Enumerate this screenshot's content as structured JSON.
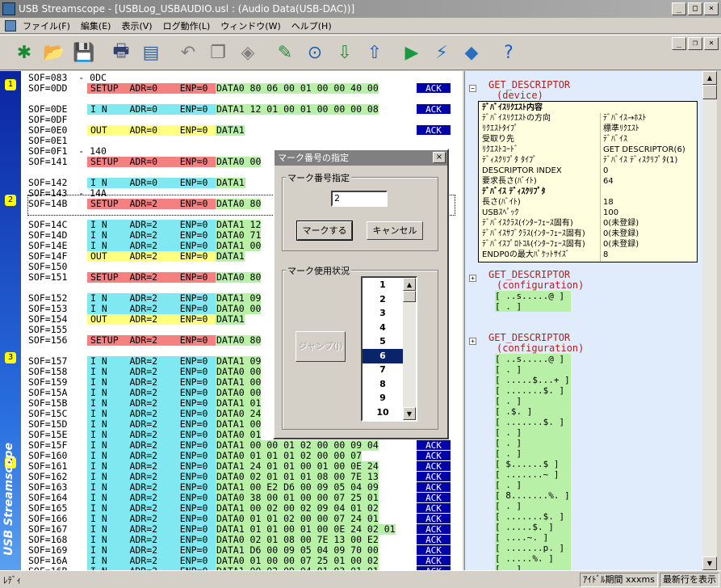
{
  "window": {
    "title": "USB Streamscope - [USBLog_USBAUDIO.usl : (Audio Data(USB-DAC))]"
  },
  "menu": [
    "ファイル(F)",
    "編集(E)",
    "表示(V)",
    "ログ動作(L)",
    "ウィンドウ(W)",
    "ヘルプ(H)"
  ],
  "sidebar": {
    "brand": "USB Streamscope",
    "marks": [
      "1",
      "2",
      "3",
      "4"
    ]
  },
  "log_rows": [
    {
      "sof": "SOF=083  - 0DC"
    },
    {
      "sof": "SOF=0DD",
      "tok": "SETUP",
      "adr": "ADR=0",
      "enp": "ENP=0",
      "data": "DATA0 80 06 00 01 00 00 40 00",
      "color": "red",
      "ack": "ACK"
    },
    {
      "sof": ""
    },
    {
      "sof": "SOF=0DE",
      "tok": "I N",
      "adr": "ADR=0",
      "enp": "ENP=0",
      "data": "DATA1 12 01 00 01 00 00 00 08",
      "color": "cyan",
      "ack": "ACK"
    },
    {
      "sof": "SOF=0DF"
    },
    {
      "sof": "SOF=0E0",
      "tok": "OUT",
      "adr": "ADR=0",
      "enp": "ENP=0",
      "data": "DATA1",
      "color": "yellow",
      "ack": "ACK"
    },
    {
      "sof": "SOF=0E1"
    },
    {
      "sof": "SOF=0F1  - 140"
    },
    {
      "sof": "SOF=141",
      "tok": "SETUP",
      "adr": "ADR=0",
      "enp": "ENP=0",
      "data": "DATA0 00",
      "color": "red"
    },
    {
      "sof": ""
    },
    {
      "sof": "SOF=142",
      "tok": "I N",
      "adr": "ADR=0",
      "enp": "ENP=0",
      "data": "DATA1",
      "color": "cyan"
    },
    {
      "sof": "SOF=143  - 14A"
    },
    {
      "sof": "SOF=14B",
      "tok": "SETUP",
      "adr": "ADR=2",
      "enp": "ENP=0",
      "data": "DATA0 80",
      "color": "red"
    },
    {
      "sof": ""
    },
    {
      "sof": "SOF=14C",
      "tok": "I N",
      "adr": "ADR=2",
      "enp": "ENP=0",
      "data": "DATA1 12",
      "color": "cyan"
    },
    {
      "sof": "SOF=14D",
      "tok": "I N",
      "adr": "ADR=2",
      "enp": "ENP=0",
      "data": "DATA0 71",
      "color": "cyan"
    },
    {
      "sof": "SOF=14E",
      "tok": "I N",
      "adr": "ADR=2",
      "enp": "ENP=0",
      "data": "DATA1 00",
      "color": "cyan"
    },
    {
      "sof": "SOF=14F",
      "tok": "OUT",
      "adr": "ADR=2",
      "enp": "ENP=0",
      "data": "DATA1",
      "color": "yellow"
    },
    {
      "sof": "SOF=150"
    },
    {
      "sof": "SOF=151",
      "tok": "SETUP",
      "adr": "ADR=2",
      "enp": "ENP=0",
      "data": "DATA0 80",
      "color": "red"
    },
    {
      "sof": ""
    },
    {
      "sof": "SOF=152",
      "tok": "I N",
      "adr": "ADR=2",
      "enp": "ENP=0",
      "data": "DATA1 09",
      "color": "cyan"
    },
    {
      "sof": "SOF=153",
      "tok": "I N",
      "adr": "ADR=2",
      "enp": "ENP=0",
      "data": "DATA0 00",
      "color": "cyan"
    },
    {
      "sof": "SOF=154",
      "tok": "OUT",
      "adr": "ADR=2",
      "enp": "ENP=0",
      "data": "DATA1",
      "color": "yellow"
    },
    {
      "sof": "SOF=155"
    },
    {
      "sof": "SOF=156",
      "tok": "SETUP",
      "adr": "ADR=2",
      "enp": "ENP=0",
      "data": "DATA0 80",
      "color": "red"
    },
    {
      "sof": ""
    },
    {
      "sof": "SOF=157",
      "tok": "I N",
      "adr": "ADR=2",
      "enp": "ENP=0",
      "data": "DATA1 09",
      "color": "cyan"
    },
    {
      "sof": "SOF=158",
      "tok": "I N",
      "adr": "ADR=2",
      "enp": "ENP=0",
      "data": "DATA0 00",
      "color": "cyan"
    },
    {
      "sof": "SOF=159",
      "tok": "I N",
      "adr": "ADR=2",
      "enp": "ENP=0",
      "data": "DATA1 00",
      "color": "cyan"
    },
    {
      "sof": "SOF=15A",
      "tok": "I N",
      "adr": "ADR=2",
      "enp": "ENP=0",
      "data": "DATA0 00",
      "color": "cyan"
    },
    {
      "sof": "SOF=15B",
      "tok": "I N",
      "adr": "ADR=2",
      "enp": "ENP=0",
      "data": "DATA1 01",
      "color": "cyan"
    },
    {
      "sof": "SOF=15C",
      "tok": "I N",
      "adr": "ADR=2",
      "enp": "ENP=0",
      "data": "DATA0 24",
      "color": "cyan"
    },
    {
      "sof": "SOF=15D",
      "tok": "I N",
      "adr": "ADR=2",
      "enp": "ENP=0",
      "data": "DATA1 00",
      "color": "cyan"
    },
    {
      "sof": "SOF=15E",
      "tok": "I N",
      "adr": "ADR=2",
      "enp": "ENP=0",
      "data": "DATA0 01",
      "color": "cyan"
    },
    {
      "sof": "SOF=15F",
      "tok": "I N",
      "adr": "ADR=2",
      "enp": "ENP=0",
      "data": "DATA1 00 00 01 02 00 00 09 04",
      "color": "cyan",
      "ack": "ACK"
    },
    {
      "sof": "SOF=160",
      "tok": "I N",
      "adr": "ADR=2",
      "enp": "ENP=0",
      "data": "DATA0 01 01 01 02 00 00 07",
      "color": "cyan",
      "ack": "ACK"
    },
    {
      "sof": "SOF=161",
      "tok": "I N",
      "adr": "ADR=2",
      "enp": "ENP=0",
      "data": "DATA1 24 01 01 00 01 00 0E 24",
      "color": "cyan",
      "ack": "ACK"
    },
    {
      "sof": "SOF=162",
      "tok": "I N",
      "adr": "ADR=2",
      "enp": "ENP=0",
      "data": "DATA0 02 01 01 01 08 00 7E 13",
      "color": "cyan",
      "ack": "ACK"
    },
    {
      "sof": "SOF=163",
      "tok": "I N",
      "adr": "ADR=2",
      "enp": "ENP=0",
      "data": "DATA1 00 E2 D6 00 09 05 04 09",
      "color": "cyan",
      "ack": "ACK"
    },
    {
      "sof": "SOF=164",
      "tok": "I N",
      "adr": "ADR=2",
      "enp": "ENP=0",
      "data": "DATA0 38 00 01 00 00 07 25 01",
      "color": "cyan",
      "ack": "ACK"
    },
    {
      "sof": "SOF=165",
      "tok": "I N",
      "adr": "ADR=2",
      "enp": "ENP=0",
      "data": "DATA1 00 02 00 02 09 04 01 02",
      "color": "cyan",
      "ack": "ACK"
    },
    {
      "sof": "SOF=166",
      "tok": "I N",
      "adr": "ADR=2",
      "enp": "ENP=0",
      "data": "DATA0 01 01 02 00 00 07 24 01",
      "color": "cyan",
      "ack": "ACK"
    },
    {
      "sof": "SOF=167",
      "tok": "I N",
      "adr": "ADR=2",
      "enp": "ENP=0",
      "data": "DATA1 01 01 00 01 00 0E 24 02 01",
      "color": "cyan",
      "ack": "ACK"
    },
    {
      "sof": "SOF=168",
      "tok": "I N",
      "adr": "ADR=2",
      "enp": "ENP=0",
      "data": "DATA0 02 01 08 00 7E 13 00 E2",
      "color": "cyan",
      "ack": "ACK"
    },
    {
      "sof": "SOF=169",
      "tok": "I N",
      "adr": "ADR=2",
      "enp": "ENP=0",
      "data": "DATA1 D6 00 09 05 04 09 70 00",
      "color": "cyan",
      "ack": "ACK"
    },
    {
      "sof": "SOF=16A",
      "tok": "I N",
      "adr": "ADR=2",
      "enp": "ENP=0",
      "data": "DATA0 01 00 00 07 25 01 00 02",
      "color": "cyan",
      "ack": "ACK"
    },
    {
      "sof": "SOF=16B",
      "tok": "I N",
      "adr": "ADR=2",
      "enp": "ENP=0",
      "data": "DATA1 00 02 09 04 01 03 01 01",
      "color": "cyan",
      "ack": "ACK"
    }
  ],
  "tree": {
    "node1": {
      "name": "GET_DESCRIPTOR",
      "sub": "(device)",
      "toggle": "⊟"
    },
    "node2": {
      "name": "GET_DESCRIPTOR",
      "sub": "(configuration)",
      "toggle": "⊞",
      "hex": "[ ..s.....@ ]\n[ . ]"
    },
    "node3": {
      "name": "GET_DESCRIPTOR",
      "sub": "(configuration)",
      "toggle": "⊞",
      "hex": "[ ..s.....@ ]\n[ . ]\n[ .....$...+ ]\n[ .......$. ]\n[ . ]\n[ .$. ]\n[ .......$. ]\n[ . ]\n[ . ]\n[ . ]\n[ $......$ ]\n[ .......~ ]\n[ . ]\n[ 8.......%. ]\n[ . ]\n[ .......$. ]\n[ .....$. ]\n[ ....~. ]\n[ .......p. ]\n[ .....%. ]\n[ . ]"
    }
  },
  "popup": {
    "rows": [
      {
        "k": "ﾃﾞﾊﾞｲｽﾘｸｴｽﾄ内容",
        "v": "",
        "head": true
      },
      {
        "k": "ﾃﾞﾊﾞｲｽﾘｸｴｽﾄの方向",
        "v": "ﾃﾞﾊﾞｲｽ→ﾎｽﾄ"
      },
      {
        "k": "ﾘｸｴｽﾄﾀｲﾌﾟ",
        "v": "標準ﾘｸｴｽﾄ"
      },
      {
        "k": "受取り先",
        "v": "ﾃﾞﾊﾞｲｽ"
      },
      {
        "k": "ﾘｸｴｽﾄｺｰﾄﾞ",
        "v": "GET DESCRIPTOR(6)"
      },
      {
        "k": "ﾃﾞｨｽｸﾘﾌﾟﾀ ﾀｲﾌﾟ",
        "v": "ﾃﾞﾊﾞｲｽ ﾃﾞｨｽｸﾘﾌﾟﾀ(1)"
      },
      {
        "k": " DESCRIPTOR INDEX",
        "v": "0"
      },
      {
        "k": " 要求長さ(ﾊﾞｲﾄ)",
        "v": "64"
      },
      {
        "k": "ﾃﾞﾊﾞｲｽ ﾃﾞｨｽｸﾘﾌﾟﾀ",
        "v": "",
        "head": true
      },
      {
        "k": "長さ(ﾊﾞｲﾄ)",
        "v": "18"
      },
      {
        "k": "USBｽﾍﾟｯｸ",
        "v": "100"
      },
      {
        "k": "ﾃﾞﾊﾞｲｽｸﾗｽ(ｲﾝﾀｰﾌｪｰｽ固有)",
        "v": "0(未登録)"
      },
      {
        "k": "ﾃﾞﾊﾞｲｽｻﾌﾞｸﾗｽ(ｲﾝﾀｰﾌｪｰｽ固有)",
        "v": "0(未登録)"
      },
      {
        "k": "ﾃﾞﾊﾞｲｽﾌﾟﾛﾄｺﾙ(ｲﾝﾀｰﾌｪｰｽ固有)",
        "v": "0(未登録)"
      },
      {
        "k": "ENDP0の最大ﾊﾟｹｯﾄｻｲｽﾞ",
        "v": "8"
      }
    ]
  },
  "dialog": {
    "title": "マーク番号の指定",
    "group1": "マーク番号指定",
    "input_value": "2",
    "ok": "マークする",
    "cancel": "キャンセル",
    "group2": "マーク使用状況",
    "jump": "ジャンプ(J)",
    "list": [
      "1",
      "2",
      "3",
      "4",
      "5",
      "6",
      "7",
      "8",
      "9",
      "10"
    ],
    "selected": "6"
  },
  "status": {
    "left": "ﾚﾃﾞｨ",
    "idle": "ｱｲﾄﾞﾙ期間 xxxms",
    "latest": "最新行を表示"
  }
}
